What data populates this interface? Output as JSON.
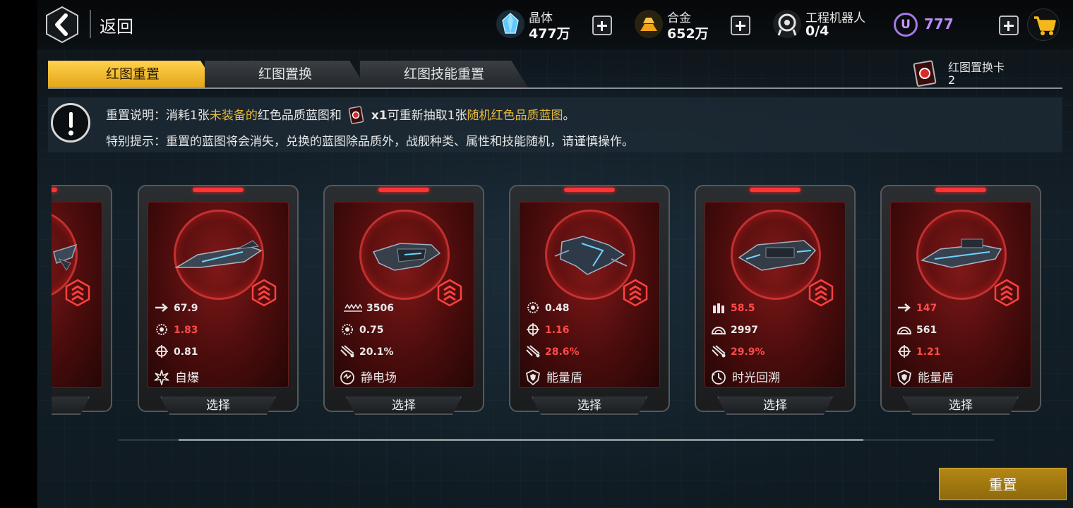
{
  "topbar": {
    "back_label": "返回",
    "resources": [
      {
        "name": "晶体",
        "value": "477万",
        "icon": "crystal-icon"
      },
      {
        "name": "合金",
        "value": "652万",
        "icon": "alloy-icon"
      },
      {
        "name": "工程机器人",
        "value": "0/4",
        "icon": "robot-icon"
      }
    ],
    "currency_symbol": "U",
    "currency_value": "777"
  },
  "tabs": [
    {
      "label": "红图重置",
      "active": true
    },
    {
      "label": "红图置换",
      "active": false
    },
    {
      "label": "红图技能重置",
      "active": false
    }
  ],
  "exchange_card": {
    "name": "红图置换卡",
    "count": "2"
  },
  "info": {
    "line1_prefix": "重置说明：消耗1张",
    "line1_hl1": "未装备的",
    "line1_mid": "红色品质蓝图和",
    "line1_qty": "x1",
    "line1_mid2": "可重新抽取1张",
    "line1_hl2": "随机红色品质蓝图",
    "line1_end": "。",
    "line2": "特别提示：重置的蓝图将会消失，兑换的蓝图除品质外，战舰种类、属性和技能随机，请谨慎操作。"
  },
  "cards": [
    {
      "stats": [
        {
          "icon": "arrow-speed-icon",
          "value": "67.9",
          "red": false
        },
        {
          "icon": "gear-rate-icon",
          "value": "1.83",
          "red": true
        },
        {
          "icon": "crosshair-icon",
          "value": "0.81",
          "red": false
        }
      ],
      "skill": "自爆",
      "skill_icon": "explosion-icon",
      "select": "选择"
    },
    {
      "stats": [
        {
          "icon": "wave-damage-icon",
          "value": "3506",
          "red": false
        },
        {
          "icon": "gear-rate-icon",
          "value": "0.75",
          "red": false
        },
        {
          "icon": "missile-icon",
          "value": "20.1%",
          "red": false
        }
      ],
      "skill": "静电场",
      "skill_icon": "static-field-icon",
      "select": "选择"
    },
    {
      "stats": [
        {
          "icon": "gear-rate-icon",
          "value": "0.48",
          "red": false
        },
        {
          "icon": "crosshair-icon",
          "value": "1.16",
          "red": true
        },
        {
          "icon": "missile-icon",
          "value": "28.6%",
          "red": true
        }
      ],
      "skill": "能量盾",
      "skill_icon": "shield-icon",
      "select": "选择"
    },
    {
      "stats": [
        {
          "icon": "ammo-icon",
          "value": "58.5",
          "red": true
        },
        {
          "icon": "armor-icon",
          "value": "2997",
          "red": false
        },
        {
          "icon": "missile-icon",
          "value": "29.9%",
          "red": true
        }
      ],
      "skill": "时光回溯",
      "skill_icon": "time-rewind-icon",
      "select": "选择"
    },
    {
      "stats": [
        {
          "icon": "arrow-speed-icon",
          "value": "147",
          "red": true
        },
        {
          "icon": "armor-icon",
          "value": "561",
          "red": false
        },
        {
          "icon": "crosshair-icon",
          "value": "1.21",
          "red": true
        }
      ],
      "skill": "能量盾",
      "skill_icon": "shield-icon",
      "select": "选择"
    }
  ],
  "partial_card": {
    "select": "择"
  },
  "reset_button": "重置",
  "colors": {
    "accent_gold": "#e7b93a",
    "stat_red": "#ff4a4a",
    "currency_purple": "#b98cf5"
  }
}
